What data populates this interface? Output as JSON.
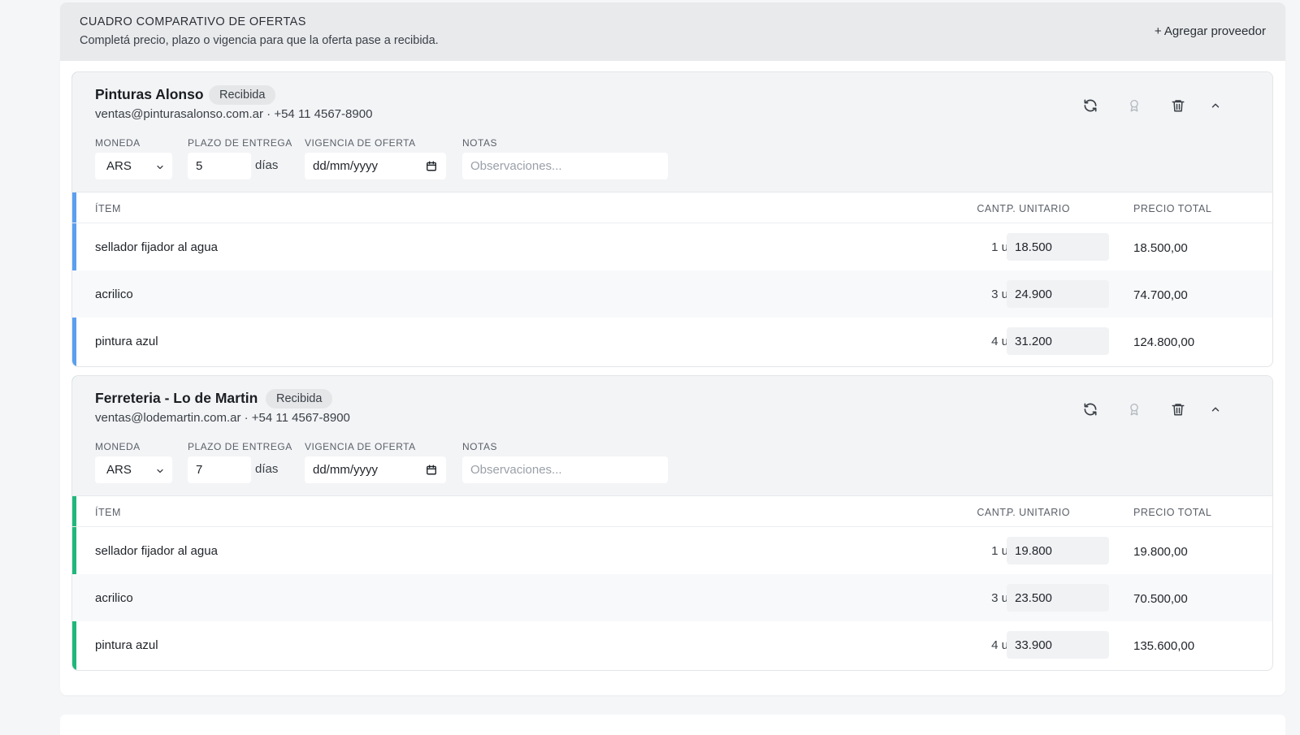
{
  "header": {
    "title": "CUADRO COMPARATIVO DE OFERTAS",
    "subtitle": "Completá precio, plazo o vigencia para que la oferta pase a recibida.",
    "add_button": "+ Agregar proveedor"
  },
  "labels": {
    "currency": "MONEDA",
    "lead_time": "PLAZO DE ENTREGA",
    "validity": "VIGENCIA DE OFERTA",
    "notes": "NOTAS",
    "days": "días",
    "notes_placeholder": "Observaciones...",
    "col_item": "ÍTEM",
    "col_qty": "CANT.",
    "col_unit": "P. UNITARIO",
    "col_total": "PRECIO TOTAL"
  },
  "colors": {
    "supplier_1_accent": "#5b9ff0",
    "supplier_2_accent": "#1fb87a"
  },
  "icons": [
    "refresh-icon",
    "award-icon",
    "trash-icon",
    "chevron-up-icon",
    "chevron-down-icon",
    "calendar-icon"
  ],
  "suppliers": [
    {
      "name": "Pinturas Alonso",
      "status": "Recibida",
      "contact": "ventas@pinturasalonso.com.ar · +54 11 4567-8900",
      "currency": "ARS",
      "lead_time": "5",
      "validity": "dd/mm/yyyy",
      "items": [
        {
          "item": "sellador fijador al agua",
          "qty": "1 u",
          "unit_price": "18.500",
          "total": "18.500,00"
        },
        {
          "item": "acrilico",
          "qty": "3 u",
          "unit_price": "24.900",
          "total": "74.700,00"
        },
        {
          "item": "pintura azul",
          "qty": "4 u",
          "unit_price": "31.200",
          "total": "124.800,00"
        }
      ]
    },
    {
      "name": "Ferreteria - Lo de Martin",
      "status": "Recibida",
      "contact": "ventas@lodemartin.com.ar · +54 11 4567-8900",
      "currency": "ARS",
      "lead_time": "7",
      "validity": "dd/mm/yyyy",
      "items": [
        {
          "item": "sellador fijador al agua",
          "qty": "1 u",
          "unit_price": "19.800",
          "total": "19.800,00"
        },
        {
          "item": "acrilico",
          "qty": "3 u",
          "unit_price": "23.500",
          "total": "70.500,00"
        },
        {
          "item": "pintura azul",
          "qty": "4 u",
          "unit_price": "33.900",
          "total": "135.600,00"
        }
      ]
    }
  ]
}
